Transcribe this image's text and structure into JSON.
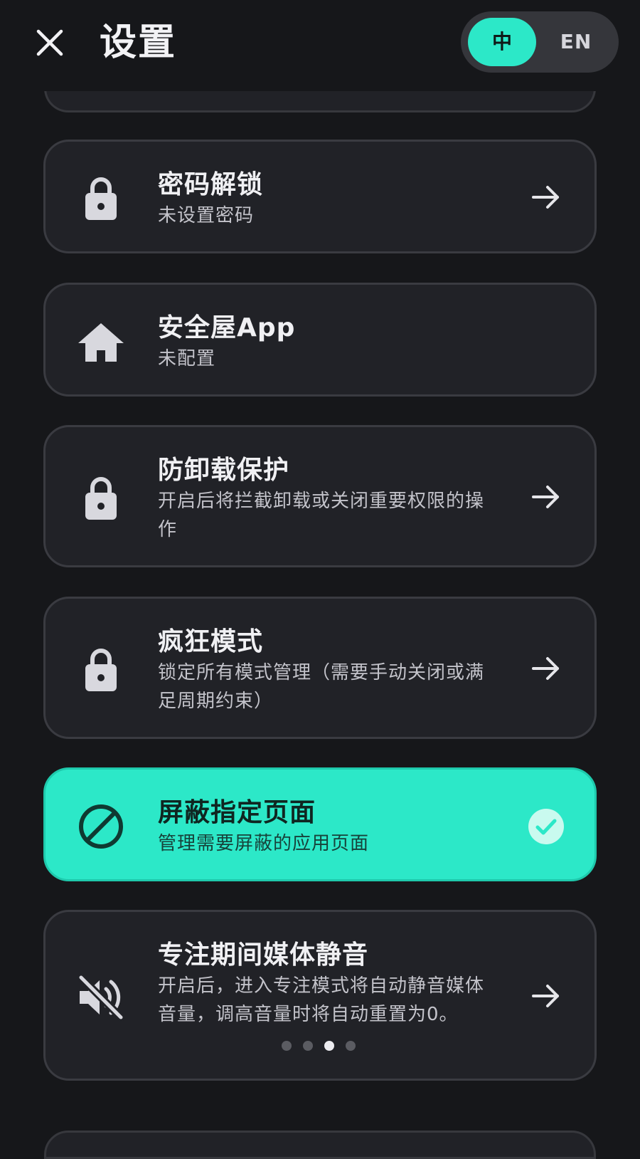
{
  "header": {
    "title": "设置",
    "lang_options": [
      "中",
      "EN"
    ],
    "lang_selected": "中"
  },
  "settings": [
    {
      "title": "密码解锁",
      "desc": "未设置密码",
      "icon": "lock-icon",
      "trailing": "arrow-right-icon"
    },
    {
      "title": "安全屋App",
      "desc": "未配置",
      "icon": "home-icon",
      "trailing": ""
    },
    {
      "title": "防卸载保护",
      "desc": "开启后将拦截卸载或关闭重要权限的操作",
      "icon": "lock-icon",
      "trailing": "arrow-right-icon"
    },
    {
      "title": "疯狂模式",
      "desc": "锁定所有模式管理（需要手动关闭或满足周期约束）",
      "icon": "lock-icon",
      "trailing": "arrow-right-icon"
    },
    {
      "title": "屏蔽指定页面",
      "desc": "管理需要屏蔽的应用页面",
      "icon": "block-icon",
      "trailing": "check-circle-icon",
      "enabled": true
    },
    {
      "title": "专注期间媒体静音",
      "desc": "开启后，进入专注模式将自动静音媒体音量，调高音量时将自动重置为0。",
      "icon": "volume-off-icon",
      "trailing": "arrow-right-icon"
    }
  ],
  "pager": {
    "count": 4,
    "current_index": 2
  },
  "colors": {
    "background": "#16171a",
    "card": "#212227",
    "accent": "#2ce8c8"
  }
}
